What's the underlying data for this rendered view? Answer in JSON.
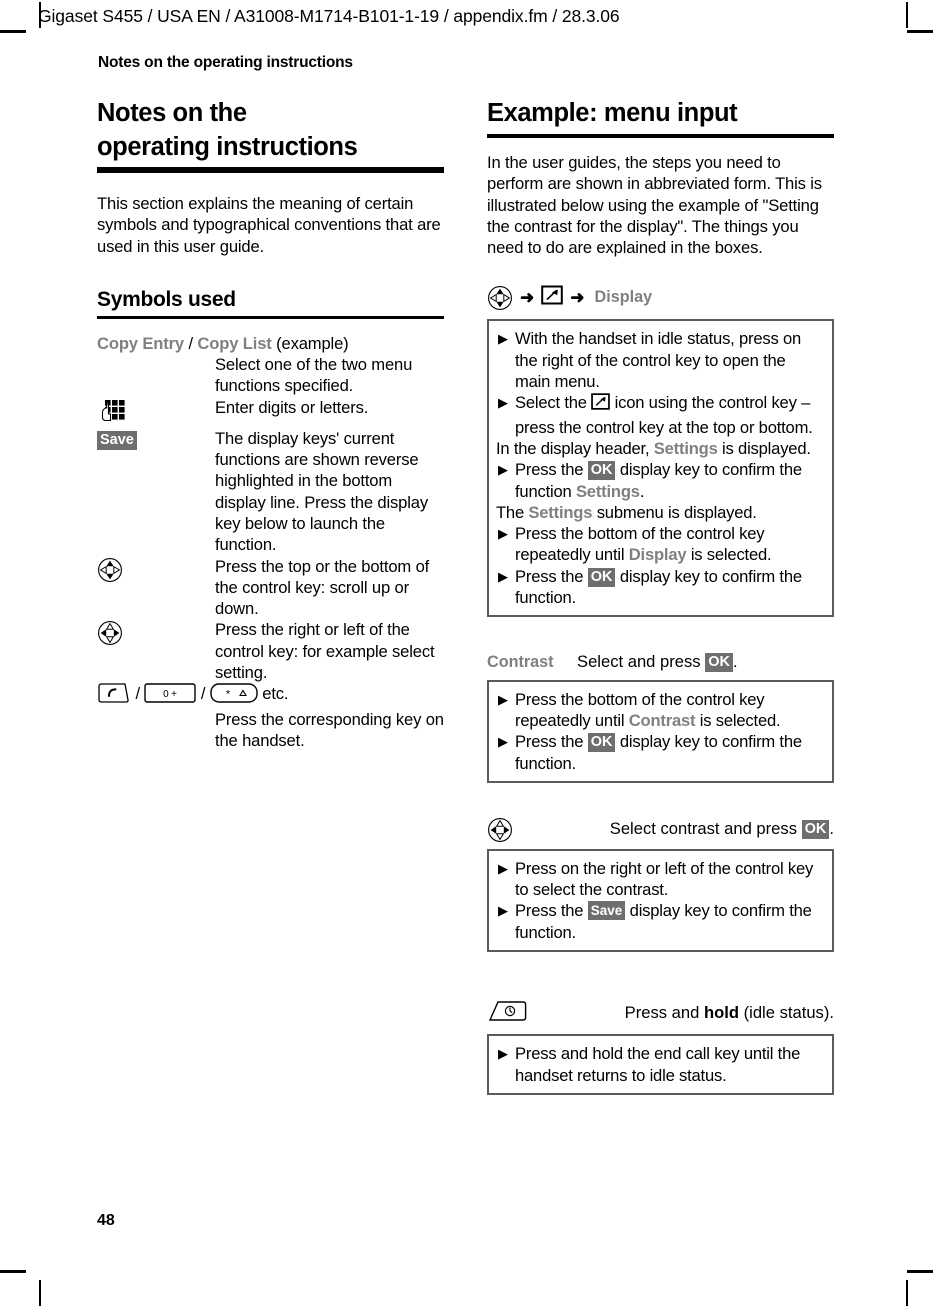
{
  "page": {
    "running_header": "Gigaset S455 / USA EN / A31008-M1714-B101-1-19  / appendix.fm / 28.3.06",
    "chapter_label": "Notes on the operating instructions",
    "page_number": "48"
  },
  "left_column": {
    "title_line1": "Notes on the",
    "title_line2": "operating instructions",
    "intro": "This section explains the meaning of certain symbols and typographical conventions that are used in this user guide.",
    "symbols_heading": "Symbols used",
    "menu_example_term": "Copy Entry",
    "menu_example_separator": " / ",
    "menu_example_term2": "Copy List",
    "menu_example_suffix": " (example)",
    "rows": [
      {
        "icon": "none",
        "desc": "Select one of the two menu functions specified."
      },
      {
        "icon": "keypad-icon",
        "desc": "Enter digits or letters."
      },
      {
        "icon": "save-display-key",
        "icon_label": "Save",
        "desc": "The display keys' current functions are shown reverse highlighted in the bottom display line. Press the display key below to launch the function."
      },
      {
        "icon": "control-key-vertical-icon",
        "desc": "Press the top or the bottom of the control key: scroll up or down."
      },
      {
        "icon": "control-key-horizontal-icon",
        "desc": "Press the right or left of the control key: for example select setting."
      }
    ],
    "handset_keys": {
      "sep": " / ",
      "etc": " etc.",
      "key_zero_label": "0 +",
      "key_star_label": "*",
      "desc": "Press the corresponding key on the handset."
    }
  },
  "right_column": {
    "title": "Example: menu input",
    "intro": "In the user guides, the steps you need to perform are shown in abbreviated form. This is illustrated below using the example of \"Setting the contrast for the display\". The things you need to do are explained in the boxes.",
    "nav": {
      "icon1": "control-key-vertical-icon",
      "arrow": "➜",
      "icon2": "settings-menu-icon",
      "label": "Display"
    },
    "box1": {
      "steps": [
        {
          "type": "bullet",
          "parts": [
            {
              "t": "text",
              "v": "With the handset in idle status, press on the right of the control key to open the main menu."
            }
          ]
        },
        {
          "type": "bullet",
          "parts": [
            {
              "t": "text",
              "v": "Select the "
            },
            {
              "t": "icon",
              "v": "settings-menu-icon"
            },
            {
              "t": "text",
              "v": " icon using the control key – press the control key at the top or bottom."
            }
          ]
        },
        {
          "type": "note",
          "parts": [
            {
              "t": "text",
              "v": "In the display header, "
            },
            {
              "t": "menu",
              "v": "Settings"
            },
            {
              "t": "text",
              "v": " is displayed."
            }
          ]
        },
        {
          "type": "bullet",
          "parts": [
            {
              "t": "text",
              "v": "Press the "
            },
            {
              "t": "chip",
              "v": "OK"
            },
            {
              "t": "text",
              "v": " display key to confirm the function "
            },
            {
              "t": "menu",
              "v": "Settings"
            },
            {
              "t": "text",
              "v": "."
            }
          ]
        },
        {
          "type": "note",
          "parts": [
            {
              "t": "text",
              "v": "The "
            },
            {
              "t": "menu",
              "v": "Settings"
            },
            {
              "t": "text",
              "v": " submenu is displayed."
            }
          ]
        },
        {
          "type": "bullet",
          "parts": [
            {
              "t": "text",
              "v": "Press the bottom of the control key repeatedly until "
            },
            {
              "t": "menu",
              "v": "Display"
            },
            {
              "t": "text",
              "v": " is selected."
            }
          ]
        },
        {
          "type": "bullet",
          "parts": [
            {
              "t": "text",
              "v": "Press the "
            },
            {
              "t": "chip",
              "v": "OK"
            },
            {
              "t": "text",
              "v": " display key to confirm the function."
            }
          ]
        }
      ]
    },
    "caption2": {
      "term": "Contrast",
      "text_before": "Select and press ",
      "chip": "OK",
      "text_after": "."
    },
    "box2": {
      "steps": [
        {
          "type": "bullet",
          "parts": [
            {
              "t": "text",
              "v": "Press the bottom of the control key repeatedly until "
            },
            {
              "t": "menu",
              "v": "Contrast"
            },
            {
              "t": "text",
              "v": " is selected."
            }
          ]
        },
        {
          "type": "bullet",
          "parts": [
            {
              "t": "text",
              "v": "Press the "
            },
            {
              "t": "chip",
              "v": "OK"
            },
            {
              "t": "text",
              "v": " display key to confirm the function."
            }
          ]
        }
      ]
    },
    "caption3": {
      "icon": "control-key-horizontal-icon",
      "text_before": "Select contrast and press ",
      "chip": "OK",
      "text_after": "."
    },
    "box3": {
      "steps": [
        {
          "type": "bullet",
          "parts": [
            {
              "t": "text",
              "v": "Press on the right or left of the control key to select the contrast."
            }
          ]
        },
        {
          "type": "bullet",
          "parts": [
            {
              "t": "text",
              "v": "Press the "
            },
            {
              "t": "chip",
              "v": "Save"
            },
            {
              "t": "text",
              "v": " display key to confirm the function."
            }
          ]
        }
      ]
    },
    "caption4": {
      "icon": "end-call-key-icon",
      "text_before": "Press and ",
      "bold": "hold",
      "text_after": " (idle status)."
    },
    "box4": {
      "steps": [
        {
          "type": "bullet",
          "parts": [
            {
              "t": "text",
              "v": "Press and hold the end call key until the handset returns to idle status."
            }
          ]
        }
      ]
    }
  },
  "colors": {
    "menu_name_gray": "#808080",
    "chip_background": "#6e6e6e",
    "box_border": "#5b5b5b",
    "rule_black": "#000000"
  }
}
